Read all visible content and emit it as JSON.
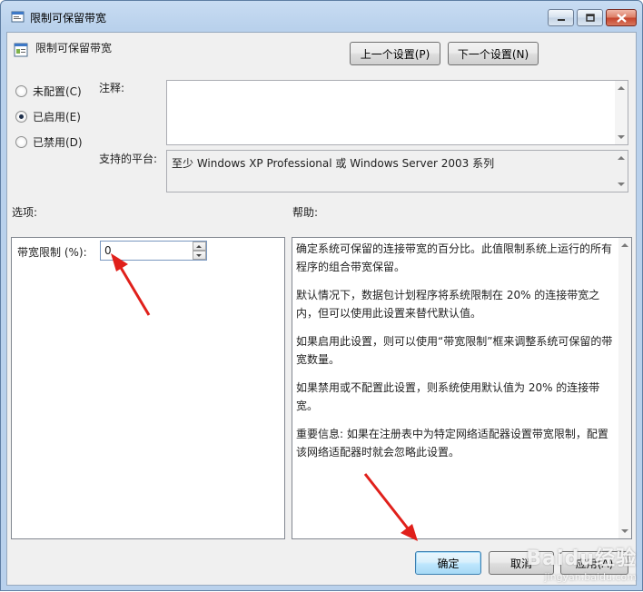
{
  "window": {
    "title": "限制可保留带宽",
    "controls": {
      "minimize": "–",
      "maximize": "□",
      "close": "✕"
    }
  },
  "header": {
    "setting_name": "限制可保留带宽",
    "prev_button": "上一个设置(P)",
    "next_button": "下一个设置(N)"
  },
  "state": {
    "options": [
      {
        "label": "未配置(C)",
        "selected": false
      },
      {
        "label": "已启用(E)",
        "selected": true
      },
      {
        "label": "已禁用(D)",
        "selected": false
      }
    ],
    "comment_label": "注释:",
    "comment_value": "",
    "platform_label": "支持的平台:",
    "platform_value": "至少 Windows XP Professional 或 Windows Server 2003 系列"
  },
  "options_section": {
    "heading": "选项:",
    "bandwidth_label": "带宽限制 (%):",
    "bandwidth_value": "0"
  },
  "help_section": {
    "heading": "帮助:",
    "paragraphs": [
      "确定系统可保留的连接带宽的百分比。此值限制系统上运行的所有程序的组合带宽保留。",
      "默认情况下，数据包计划程序将系统限制在 20% 的连接带宽之内，但可以使用此设置来替代默认值。",
      "如果启用此设置，则可以使用“带宽限制”框来调整系统可保留的带宽数量。",
      "如果禁用或不配置此设置，则系统使用默认值为 20% 的连接带宽。",
      "重要信息: 如果在注册表中为特定网络适配器设置带宽限制，配置该网络适配器时就会忽略此设置。"
    ]
  },
  "footer": {
    "ok_button": "确定",
    "cancel_button": "取消",
    "apply_button": "应用(A)"
  },
  "watermark": {
    "main": "Baidu经验",
    "sub": "jingyan.baidu.com"
  },
  "colors": {
    "annotation_arrow": "#e0201b",
    "titlebar": "#b9d1ec",
    "close_button": "#c5432b"
  }
}
